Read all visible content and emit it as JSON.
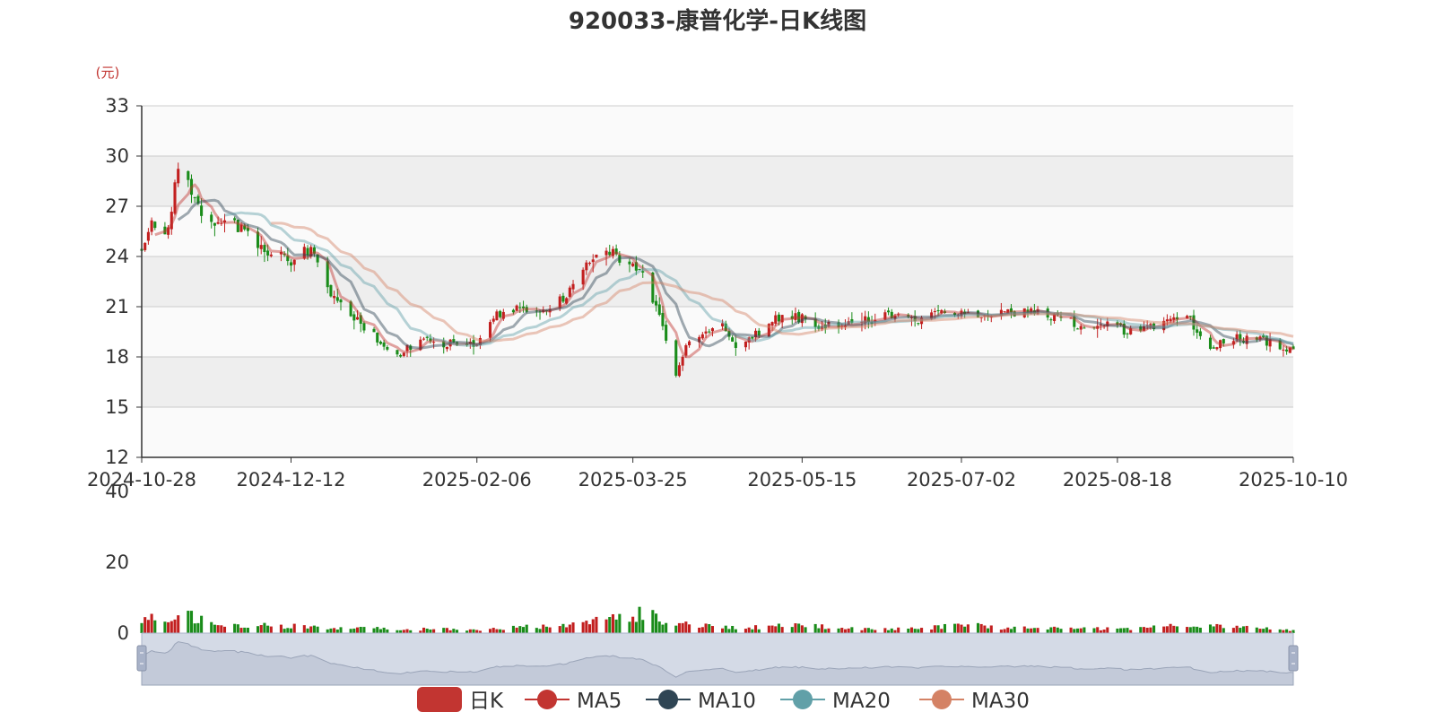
{
  "chart_data": {
    "type": "candlestick",
    "title": "920033-康普化学-日K线图",
    "yunit": "(元)",
    "price_axis": {
      "ylim": [
        12,
        33
      ],
      "ticks": [
        12,
        15,
        18,
        21,
        24,
        27,
        30,
        33
      ]
    },
    "volume_axis": {
      "ylim": [
        0,
        40
      ],
      "ticks": [
        0,
        20,
        40
      ]
    },
    "x_tick_labels": [
      "2024-10-28",
      "2024-12-12",
      "2025-02-06",
      "2025-03-25",
      "2025-05-15",
      "2025-07-02",
      "2025-08-18",
      "2025-10-10"
    ],
    "x_ticks": [
      "2024-10-28",
      "2024-12-12",
      "2025-02-06",
      "2025-03-25",
      "2025-05-15",
      "2025-07-02",
      "2025-08-18",
      "2025-10-10"
    ],
    "grid": true,
    "legend_position": "bottom",
    "legend": [
      {
        "name": "日K",
        "color": "#c23531",
        "kind": "rect"
      },
      {
        "name": "MA5",
        "color": "#c23531",
        "kind": "line"
      },
      {
        "name": "MA10",
        "color": "#2f4554",
        "kind": "line"
      },
      {
        "name": "MA20",
        "color": "#61a0a8",
        "kind": "line"
      },
      {
        "name": "MA30",
        "color": "#d48265",
        "kind": "line"
      }
    ],
    "colors": {
      "up": "#c21f1f",
      "down": "#1a8c1a",
      "axis": "#333333",
      "unit": "#c23531"
    },
    "series_anchors": {
      "close": [
        [
          "2024-10-28",
          24.5
        ],
        [
          "2024-10-31",
          26.2
        ],
        [
          "2024-11-05",
          25.4
        ],
        [
          "2024-11-08",
          29.5
        ],
        [
          "2024-11-11",
          28.2
        ],
        [
          "2024-11-15",
          26.5
        ],
        [
          "2024-11-22",
          26.0
        ],
        [
          "2024-11-29",
          25.5
        ],
        [
          "2024-12-05",
          24.1
        ],
        [
          "2024-12-12",
          23.8
        ],
        [
          "2024-12-18",
          24.5
        ],
        [
          "2024-12-24",
          21.8
        ],
        [
          "2025-01-02",
          20.0
        ],
        [
          "2025-01-08",
          18.8
        ],
        [
          "2025-01-13",
          18.0
        ],
        [
          "2025-01-17",
          18.7
        ],
        [
          "2025-01-22",
          19.3
        ],
        [
          "2025-01-27",
          18.8
        ],
        [
          "2025-02-06",
          18.6
        ],
        [
          "2025-02-11",
          20.4
        ],
        [
          "2025-02-17",
          20.9
        ],
        [
          "2025-02-24",
          20.5
        ],
        [
          "2025-03-03",
          21.4
        ],
        [
          "2025-03-07",
          22.2
        ],
        [
          "2025-03-12",
          23.6
        ],
        [
          "2025-03-18",
          24.3
        ],
        [
          "2025-03-24",
          23.4
        ],
        [
          "2025-03-27",
          23.2
        ],
        [
          "2025-04-02",
          20.5
        ],
        [
          "2025-04-07",
          16.8
        ],
        [
          "2025-04-10",
          18.9
        ],
        [
          "2025-04-16",
          19.5
        ],
        [
          "2025-04-21",
          20.0
        ],
        [
          "2025-04-25",
          18.6
        ],
        [
          "2025-04-30",
          19.2
        ],
        [
          "2025-05-09",
          20.5
        ],
        [
          "2025-05-15",
          20.3
        ],
        [
          "2025-05-21",
          19.8
        ],
        [
          "2025-05-28",
          20.0
        ],
        [
          "2025-06-05",
          20.2
        ],
        [
          "2025-06-12",
          20.5
        ],
        [
          "2025-06-18",
          20.1
        ],
        [
          "2025-06-25",
          20.5
        ],
        [
          "2025-07-01",
          20.8
        ],
        [
          "2025-07-04",
          20.6
        ],
        [
          "2025-07-10",
          20.7
        ],
        [
          "2025-07-17",
          20.7
        ],
        [
          "2025-07-24",
          20.6
        ],
        [
          "2025-07-31",
          20.3
        ],
        [
          "2025-08-07",
          19.9
        ],
        [
          "2025-08-14",
          19.9
        ],
        [
          "2025-08-20",
          19.6
        ],
        [
          "2025-08-27",
          19.8
        ],
        [
          "2025-09-03",
          20.3
        ],
        [
          "2025-09-08",
          20.4
        ],
        [
          "2025-09-15",
          18.7
        ],
        [
          "2025-09-22",
          19.1
        ],
        [
          "2025-09-29",
          19.0
        ],
        [
          "2025-10-10",
          18.5
        ]
      ],
      "volume": [
        [
          "2024-10-28",
          3.5
        ],
        [
          "2024-11-08",
          5.5
        ],
        [
          "2024-11-22",
          2.5
        ],
        [
          "2024-12-12",
          2.0
        ],
        [
          "2025-01-10",
          1.2
        ],
        [
          "2025-02-06",
          1.0
        ],
        [
          "2025-03-07",
          2.5
        ],
        [
          "2025-03-20",
          4.0
        ],
        [
          "2025-03-28",
          5.5
        ],
        [
          "2025-04-08",
          2.5
        ],
        [
          "2025-04-25",
          1.5
        ],
        [
          "2025-05-15",
          2.2
        ],
        [
          "2025-06-05",
          1.2
        ],
        [
          "2025-06-20",
          1.4
        ],
        [
          "2025-07-03",
          2.5
        ],
        [
          "2025-07-15",
          1.5
        ],
        [
          "2025-08-01",
          1.3
        ],
        [
          "2025-08-18",
          1.2
        ],
        [
          "2025-09-05",
          2.0
        ],
        [
          "2025-09-22",
          1.8
        ],
        [
          "2025-10-10",
          0.8
        ]
      ]
    }
  }
}
